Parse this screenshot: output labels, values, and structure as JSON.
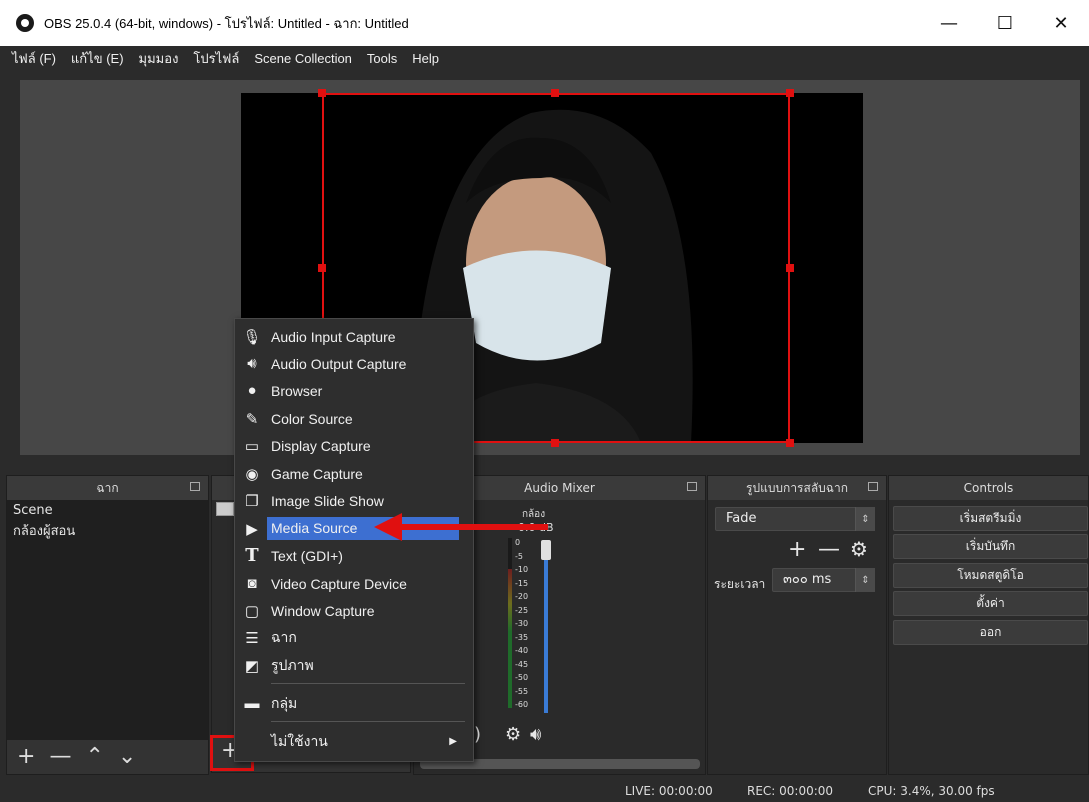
{
  "window": {
    "title": "OBS 25.0.4 (64-bit, windows) - โปรไฟล์: Untitled - ฉาก: Untitled",
    "minimize": "—",
    "maximize": "☐",
    "close": "✕"
  },
  "menu": [
    "ไฟล์ (F)",
    "แก้ไข (E)",
    "มุมมอง",
    "โปรไฟล์",
    "Scene Collection",
    "Tools",
    "Help"
  ],
  "scenes": {
    "title": "ฉาก",
    "items": [
      "Scene",
      "กล้องผู้สอน"
    ]
  },
  "audio_mixer": {
    "title": "Audio Mixer",
    "channel": "กล้อง",
    "db": "0.0 dB",
    "scale": [
      "0",
      "-5",
      "-10",
      "-15",
      "-20",
      "-25",
      "-30",
      "-35",
      "-40",
      "-45",
      "-50",
      "-55",
      "-60"
    ],
    "level_fraction": 0.82
  },
  "transitions": {
    "title": "รูปแบบการสลับฉาก",
    "selected": "Fade",
    "duration_label": "ระยะเวลา",
    "duration_value": "๓๐๐ ms"
  },
  "controls": {
    "title": "Controls",
    "buttons": [
      "เริ่มสตรีมมิ่ง",
      "เริ่มบันทึก",
      "โหมดสตูดิโอ",
      "ตั้งค่า",
      "ออก"
    ]
  },
  "context_menu": {
    "items": [
      {
        "label": "Audio Input Capture",
        "icon": "microphone-icon"
      },
      {
        "label": "Audio Output Capture",
        "icon": "speaker-icon"
      },
      {
        "label": "Browser",
        "icon": "globe-icon"
      },
      {
        "label": "Color Source",
        "icon": "brush-icon"
      },
      {
        "label": "Display Capture",
        "icon": "monitor-icon"
      },
      {
        "label": "Game Capture",
        "icon": "gamepad-icon"
      },
      {
        "label": "Image Slide Show",
        "icon": "slideshow-icon"
      },
      {
        "label": "Media Source",
        "icon": "play-icon"
      },
      {
        "label": "Text (GDI+)",
        "icon": "text-icon"
      },
      {
        "label": "Video Capture Device",
        "icon": "camera-icon"
      },
      {
        "label": "Window Capture",
        "icon": "window-icon"
      },
      {
        "label": "ฉาก",
        "icon": "list-icon"
      },
      {
        "label": "รูปภาพ",
        "icon": "image-icon"
      },
      {
        "label": "กลุ่ม",
        "icon": "folder-icon"
      },
      {
        "label": "ไม่ใช้งาน",
        "icon": "submenu-arrow-icon"
      }
    ],
    "highlighted": "Media Source"
  },
  "status": {
    "live": "LIVE: 00:00:00",
    "rec": "REC: 00:00:00",
    "cpu": "CPU: 3.4%, 30.00 fps"
  },
  "colors": {
    "accent": "#3d6fd1",
    "annotation": "#e01010"
  }
}
